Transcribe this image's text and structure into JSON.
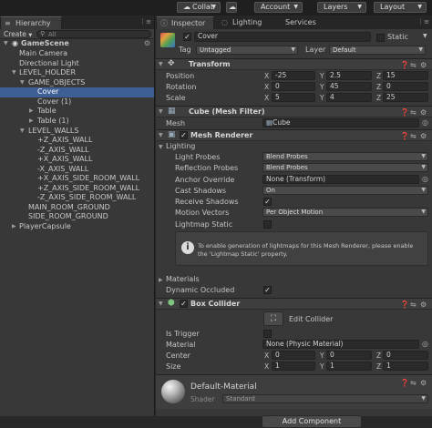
{
  "toolbar": {
    "collab": "Collab",
    "account": "Account",
    "layers": "Layers",
    "layout": "Layout"
  },
  "hierarchy": {
    "tab": "Hierarchy",
    "create": "Create",
    "search_placeholder": "All",
    "scene": "GameScene",
    "items": [
      "Main Camera",
      "Directional Light",
      "LEVEL_HOLDER",
      "GAME_OBJECTS",
      "Cover",
      "Cover (1)",
      "Table",
      "Table (1)",
      "LEVEL_WALLS",
      "+Z_AXIS_WALL",
      "-Z_AXIS_WALL",
      "+X_AXIS_WALL",
      "-X_AXIS_WALL",
      "+X_AXIS_SIDE_ROOM_WALL",
      "+Z_AXIS_SIDE_ROOM_WALL",
      "-Z_AXIS_SIDE_ROOM_WALL",
      "MAIN_ROOM_GROUND",
      "SIDE_ROOM_GROUND",
      "PlayerCapsule"
    ]
  },
  "inspector": {
    "tabs": [
      "Inspector",
      "Lighting",
      "Services"
    ],
    "object_name": "Cover",
    "static_label": "Static",
    "tag_label": "Tag",
    "tag_value": "Untagged",
    "layer_label": "Layer",
    "layer_value": "Default",
    "transform": {
      "title": "Transform",
      "position_label": "Position",
      "rotation_label": "Rotation",
      "scale_label": "Scale",
      "x": "X",
      "y": "Y",
      "z": "Z",
      "position": [
        "-25",
        "2.5",
        "15"
      ],
      "rotation": [
        "0",
        "45",
        "0"
      ],
      "scale": [
        "5",
        "4",
        "25"
      ]
    },
    "mesh_filter": {
      "title": "Cube (Mesh Filter)",
      "mesh_label": "Mesh",
      "mesh_value": "Cube"
    },
    "mesh_renderer": {
      "title": "Mesh Renderer",
      "lighting": "Lighting",
      "light_probes_label": "Light Probes",
      "light_probes_value": "Blend Probes",
      "reflection_probes_label": "Reflection Probes",
      "reflection_probes_value": "Blend Probes",
      "anchor_override_label": "Anchor Override",
      "anchor_override_value": "None (Transform)",
      "cast_shadows_label": "Cast Shadows",
      "cast_shadows_value": "On",
      "receive_shadows_label": "Receive Shadows",
      "motion_vectors_label": "Motion Vectors",
      "motion_vectors_value": "Per Object Motion",
      "lightmap_static_label": "Lightmap Static",
      "info_line1": "To enable generation of lightmaps for this Mesh Renderer, please enable",
      "info_line2": "the 'Lightmap Static' property.",
      "materials": "Materials",
      "dynamic_occluded_label": "Dynamic Occluded"
    },
    "box_collider": {
      "title": "Box Collider",
      "edit_collider": "Edit Collider",
      "is_trigger_label": "Is Trigger",
      "material_label": "Material",
      "material_value": "None (Physic Material)",
      "center_label": "Center",
      "center": [
        "0",
        "0",
        "0"
      ],
      "size_label": "Size",
      "size": [
        "1",
        "1",
        "1"
      ]
    },
    "material": {
      "name": "Default-Material",
      "shader_label": "Shader",
      "shader_value": "Standard"
    },
    "add_component": "Add Component"
  },
  "colors": {
    "selection": "#3e5f96",
    "panel": "#383838",
    "background": "#282828"
  }
}
